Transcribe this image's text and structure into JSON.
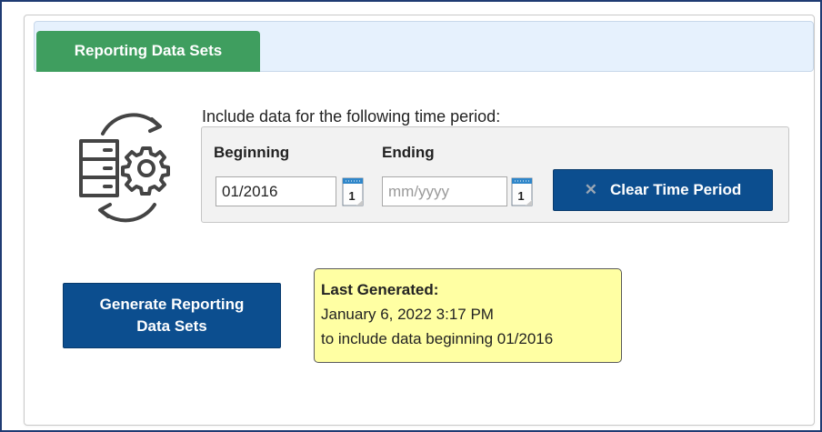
{
  "tab": {
    "label": "Reporting Data Sets"
  },
  "time_period": {
    "prompt": "Include data for the following time period:",
    "beginning_label": "Beginning",
    "ending_label": "Ending",
    "beginning_value": "01/2016",
    "ending_value": "",
    "ending_placeholder": "mm/yyyy",
    "calendar_day": "1",
    "clear_button_label": "Clear Time Period"
  },
  "generate_button": {
    "line1": "Generate Reporting",
    "line2": "Data Sets"
  },
  "last_generated": {
    "title": "Last Generated:",
    "datetime": "January 6, 2022 3:17 PM",
    "note": "to include data beginning 01/2016"
  },
  "colors": {
    "tab_green": "#3f9e5f",
    "button_blue": "#0c4e8f",
    "tab_bar_bg": "#e6f1fd",
    "note_yellow": "#ffffa3",
    "frame_border": "#1f3b73"
  },
  "icons": {
    "sync": "database-sync-icon",
    "calendar": "calendar-icon",
    "clear": "x-icon"
  }
}
